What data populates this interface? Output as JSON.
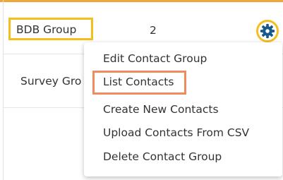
{
  "rows": [
    {
      "name": "BDB Group",
      "count": "2"
    },
    {
      "name": "Survey Gro"
    }
  ],
  "menu": {
    "items": [
      "Edit Contact Group",
      "List Contacts",
      "Create New Contacts",
      "Upload Contacts From CSV",
      "Delete Contact Group"
    ]
  },
  "colors": {
    "accent": "#f0a63a",
    "highlight": "#f4be1e",
    "menu_highlight": "#f08a5f",
    "gear": "#17598a"
  },
  "icons": {
    "settings": "gear-icon"
  }
}
